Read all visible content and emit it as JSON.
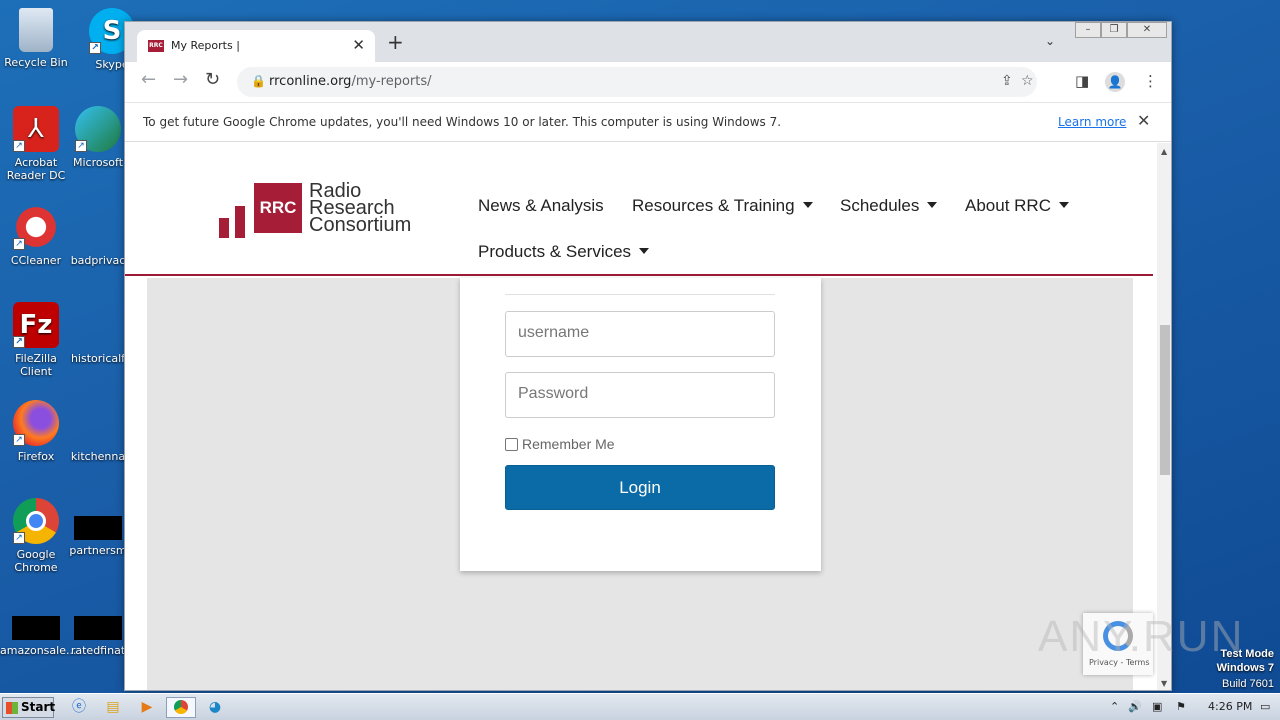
{
  "desktop": {
    "icons": [
      {
        "label": "Recycle Bin",
        "icon": "recycle-bin-icon"
      },
      {
        "label": "Skype",
        "icon": "skype-icon"
      },
      {
        "label": "Acrobat Reader DC",
        "icon": "acrobat-icon"
      },
      {
        "label": "Microsoft",
        "icon": "edge-icon"
      },
      {
        "label": "CCleaner",
        "icon": "ccleaner-icon"
      },
      {
        "label": "badprivac",
        "icon": "file-icon"
      },
      {
        "label": "FileZilla Client",
        "icon": "filezilla-icon"
      },
      {
        "label": "historicalf",
        "icon": "file-icon"
      },
      {
        "label": "Firefox",
        "icon": "firefox-icon"
      },
      {
        "label": "kitchenna",
        "icon": "file-icon"
      },
      {
        "label": "Google Chrome",
        "icon": "chrome-icon"
      },
      {
        "label": "partnersm",
        "icon": "file-icon"
      },
      {
        "label": "amazonsale...",
        "icon": "file-icon"
      },
      {
        "label": "ratedfinat",
        "icon": "file-icon"
      }
    ]
  },
  "browser": {
    "tab_title": "My Reports |",
    "url_host": "rrconline.org",
    "url_path": "/my-reports/",
    "infobar_message": "To get future Google Chrome updates, you'll need Windows 10 or later. This computer is using Windows 7.",
    "infobar_link": "Learn more"
  },
  "site": {
    "logo_abbr": "RRC",
    "logo_line1": "Radio",
    "logo_line2": "Research",
    "logo_line3": "Consortium",
    "nav": [
      "News & Analysis",
      "Resources & Training",
      "Schedules",
      "About RRC",
      "Products & Services"
    ],
    "login": {
      "username_placeholder": "username",
      "password_placeholder": "Password",
      "remember_label": "Remember Me",
      "button_label": "Login"
    },
    "recaptcha_text": "Privacy - Terms"
  },
  "watermark": "ANY.RUN",
  "system": {
    "test_mode": "Test Mode",
    "os_name": "Windows 7",
    "build": "Build 7601",
    "start_label": "Start",
    "clock": "4:26 PM"
  },
  "colors": {
    "brand": "#a51d36",
    "login_button": "#0b6ba6"
  }
}
